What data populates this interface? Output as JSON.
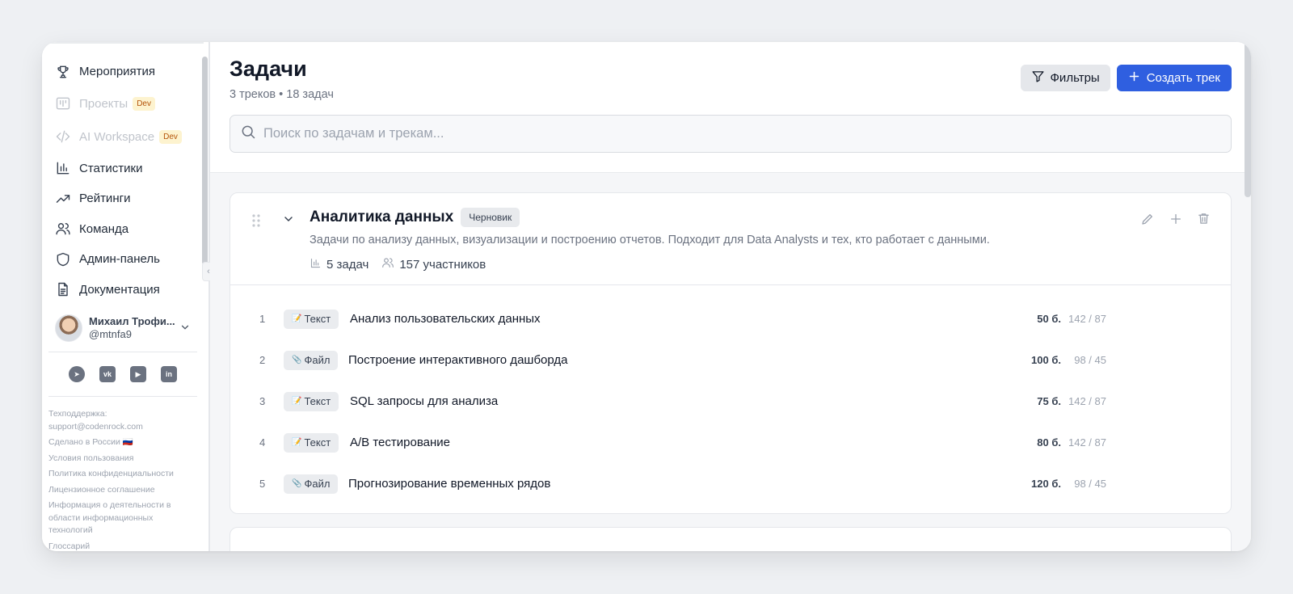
{
  "sidebar": {
    "nav": [
      {
        "label": "Мероприятия",
        "icon": "trophy-icon",
        "disabled": false
      },
      {
        "label": "Проекты",
        "icon": "kanban-icon",
        "disabled": true,
        "badge": "Dev"
      },
      {
        "label": "AI Workspace",
        "icon": "code-icon",
        "disabled": true,
        "badge": "Dev"
      },
      {
        "label": "Статистики",
        "icon": "bar-chart-icon",
        "disabled": false
      },
      {
        "label": "Рейтинги",
        "icon": "trending-up-icon",
        "disabled": false
      },
      {
        "label": "Команда",
        "icon": "users-icon",
        "disabled": false
      },
      {
        "label": "Админ-панель",
        "icon": "shield-icon",
        "disabled": false
      },
      {
        "label": "Документация",
        "icon": "document-icon",
        "disabled": false
      }
    ],
    "user": {
      "name": "Михаил Трофи...",
      "handle": "@mtnfa9"
    },
    "footer": {
      "support_label": "Техподдержка:",
      "support_email": "support@codenrock.com",
      "made_in": "Сделано в России 🇷🇺",
      "terms": "Условия пользования",
      "privacy": "Политика конфиденциальности",
      "license": "Лицензионное соглашение",
      "it_info": "Информация о деятельности в области информационных технологий",
      "glossary": "Глоссарий"
    }
  },
  "header": {
    "title": "Задачи",
    "subtitle": "3 треков • 18 задач",
    "filter_label": "Фильтры",
    "create_label": "Создать трек",
    "search_placeholder": "Поиск по задачам и трекам..."
  },
  "track": {
    "title": "Аналитика данных",
    "status": "Черновик",
    "description": "Задачи по анализу данных, визуализации и построению отчетов. Подходит для Data Analysts и тех, кто работает с данными.",
    "tasks_count": "5 задач",
    "participants": "157 участников",
    "tasks": [
      {
        "num": "1",
        "type": "Текст",
        "type_icon": "📝",
        "name": "Анализ пользовательских данных",
        "points": "50 б.",
        "stats": "142 / 87"
      },
      {
        "num": "2",
        "type": "Файл",
        "type_icon": "📎",
        "name": "Построение интерактивного дашборда",
        "points": "100 б.",
        "stats": "98 / 45"
      },
      {
        "num": "3",
        "type": "Текст",
        "type_icon": "📝",
        "name": "SQL запросы для анализа",
        "points": "75 б.",
        "stats": "142 / 87"
      },
      {
        "num": "4",
        "type": "Текст",
        "type_icon": "📝",
        "name": "A/B тестирование",
        "points": "80 б.",
        "stats": "142 / 87"
      },
      {
        "num": "5",
        "type": "Файл",
        "type_icon": "📎",
        "name": "Прогнозирование временных рядов",
        "points": "120 б.",
        "stats": "98 / 45"
      }
    ]
  },
  "colors": {
    "accent": "#2f5fe0",
    "badge_dev_bg": "#fdf3cf",
    "badge_dev_text": "#b45309"
  }
}
